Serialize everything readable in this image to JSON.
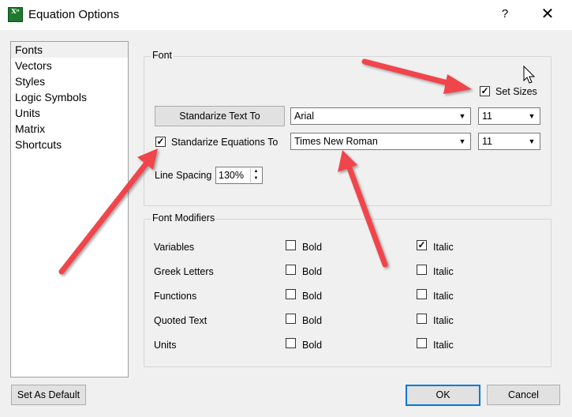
{
  "window": {
    "title": "Equation Options",
    "icon_label": "Xⁿ",
    "help_label": "?",
    "close_label": "✕"
  },
  "nav": {
    "items": [
      "Fonts",
      "Vectors",
      "Styles",
      "Logic Symbols",
      "Units",
      "Matrix",
      "Shortcuts"
    ],
    "selected": "Fonts"
  },
  "font_group": {
    "title": "Font",
    "set_sizes_label": "Set Sizes",
    "set_sizes_checked": true,
    "standardize_text_button": "Standarize Text To",
    "text_font": "Arial",
    "text_size": "11",
    "standardize_equations_label": "Standarize Equations To",
    "standardize_equations_checked": true,
    "equation_font": "Times New Roman",
    "equation_size": "11",
    "line_spacing_label": "Line Spacing",
    "line_spacing_value": "130%"
  },
  "modifiers": {
    "title": "Font Modifiers",
    "bold_label": "Bold",
    "italic_label": "Italic",
    "rows": [
      {
        "name": "Variables",
        "bold": false,
        "italic": true
      },
      {
        "name": "Greek Letters",
        "bold": false,
        "italic": false
      },
      {
        "name": "Functions",
        "bold": false,
        "italic": false
      },
      {
        "name": "Quoted Text",
        "bold": false,
        "italic": false
      },
      {
        "name": "Units",
        "bold": false,
        "italic": false
      }
    ]
  },
  "footer": {
    "set_default_label": "Set As Default",
    "ok_label": "OK",
    "cancel_label": "Cancel"
  },
  "colors": {
    "annotation_arrow": "#f0454b",
    "focus_border": "#0078d7"
  }
}
